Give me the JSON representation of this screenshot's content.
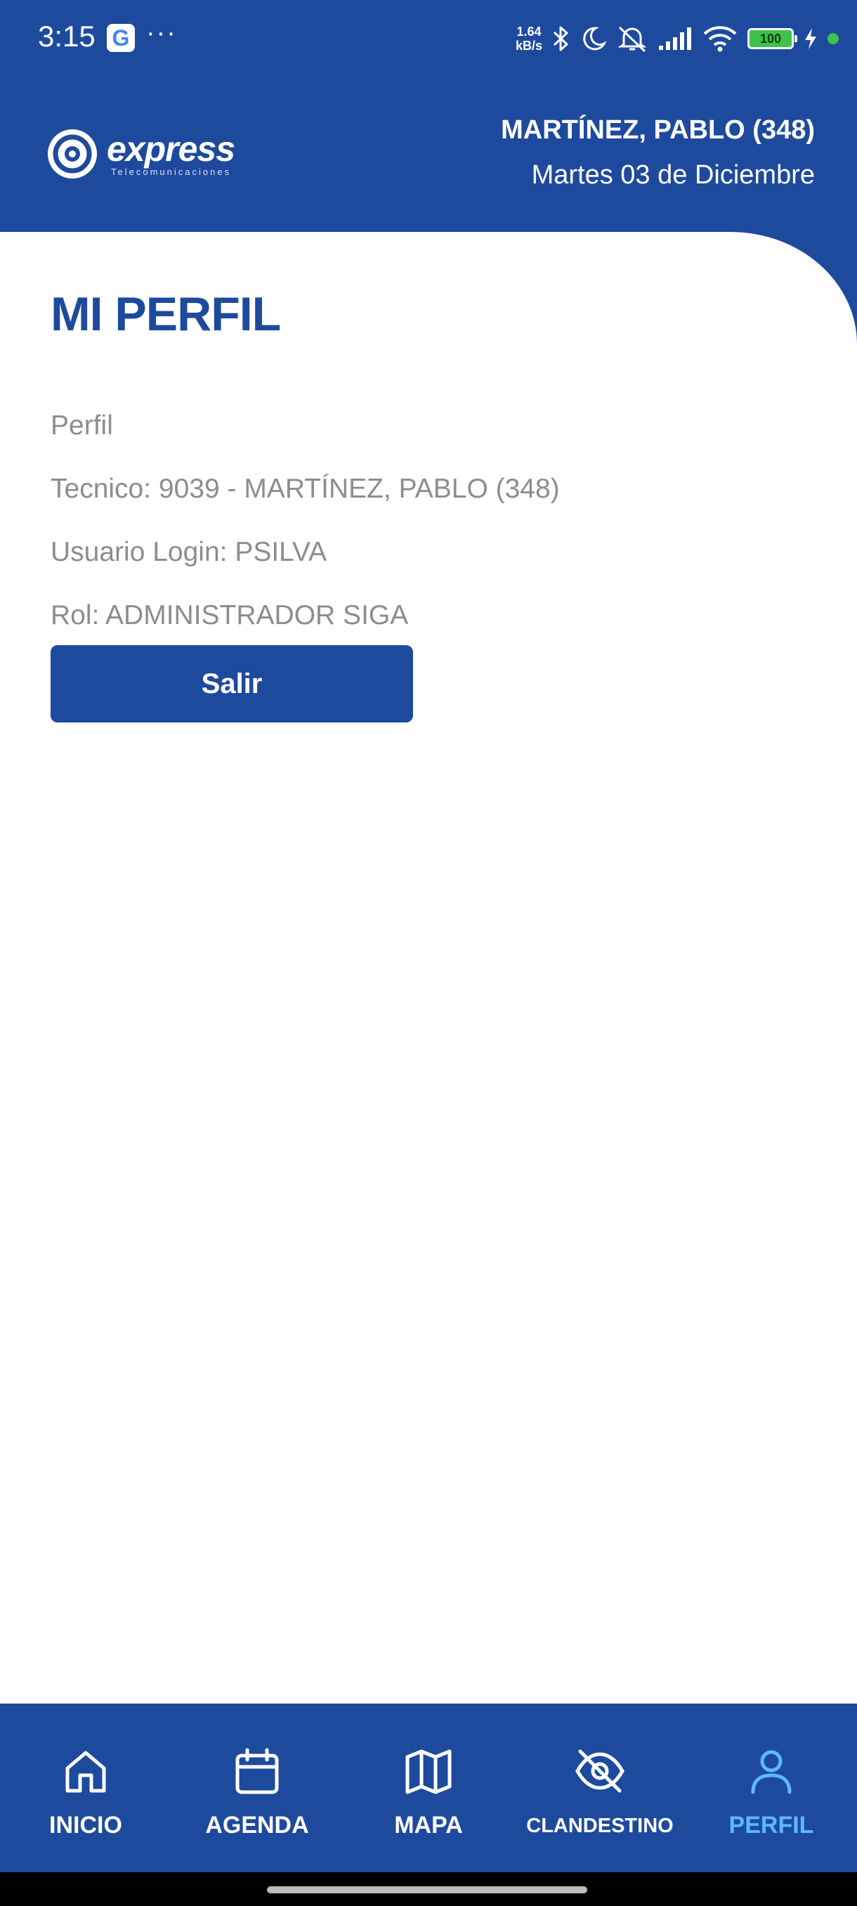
{
  "status_bar": {
    "time": "3:15",
    "g_icon": "G",
    "dots": "···",
    "speed_value": "1.64",
    "speed_unit": "kB/s",
    "battery": "100",
    "icons": [
      "bluetooth-icon",
      "moon-icon",
      "mute-icon",
      "signal-icon",
      "wifi-icon",
      "battery-icon",
      "charging-icon"
    ]
  },
  "header": {
    "logo_word": "express",
    "logo_sub": "Telecomunicaciones",
    "user_name": "MARTÍNEZ, PABLO (348)",
    "date": "Martes 03 de Diciembre"
  },
  "profile": {
    "title": "MI PERFIL",
    "section": "Perfil",
    "tecnico": "Tecnico: 9039 - MARTÍNEZ, PABLO (348)",
    "usuario": "Usuario Login: PSILVA",
    "rol": "Rol: ADMINISTRADOR SIGA",
    "logout_label": "Salir"
  },
  "nav": {
    "items": [
      {
        "label": "INICIO",
        "icon": "home-icon"
      },
      {
        "label": "AGENDA",
        "icon": "calendar-icon"
      },
      {
        "label": "MAPA",
        "icon": "map-icon"
      },
      {
        "label": "CLANDESTINO",
        "icon": "eye-off-icon"
      },
      {
        "label": "PERFIL",
        "icon": "user-icon"
      }
    ],
    "active": "PERFIL"
  },
  "colors": {
    "primary": "#1e4a9e",
    "active_nav": "#5cb8ff",
    "muted_text": "#8a8d91",
    "background": "#ffffff"
  }
}
